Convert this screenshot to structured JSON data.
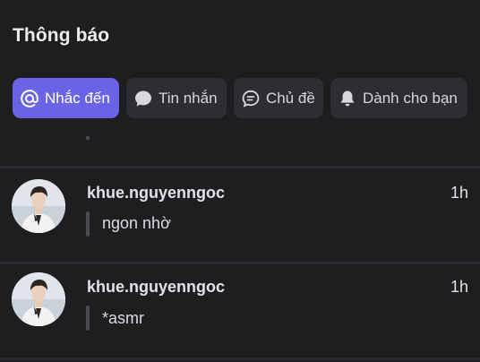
{
  "header": {
    "title": "Thông báo"
  },
  "tabs": [
    {
      "label": "Nhắc đến",
      "icon": "at-icon",
      "active": true
    },
    {
      "label": "Tin nhắn",
      "icon": "chat-bubble-icon",
      "active": false
    },
    {
      "label": "Chủ đề",
      "icon": "topic-bubble-icon",
      "active": false
    },
    {
      "label": "Dành cho bạn",
      "icon": "bell-icon",
      "active": false
    }
  ],
  "notifications": [
    {
      "username": "khue.nguyenngoc",
      "time": "1h",
      "message": "ngon nhờ"
    },
    {
      "username": "khue.nguyenngoc",
      "time": "1h",
      "message": "*asmr"
    }
  ],
  "colors": {
    "background": "#1e1e21",
    "accent": "#6a63e6",
    "tab_background": "#2d2d32"
  }
}
